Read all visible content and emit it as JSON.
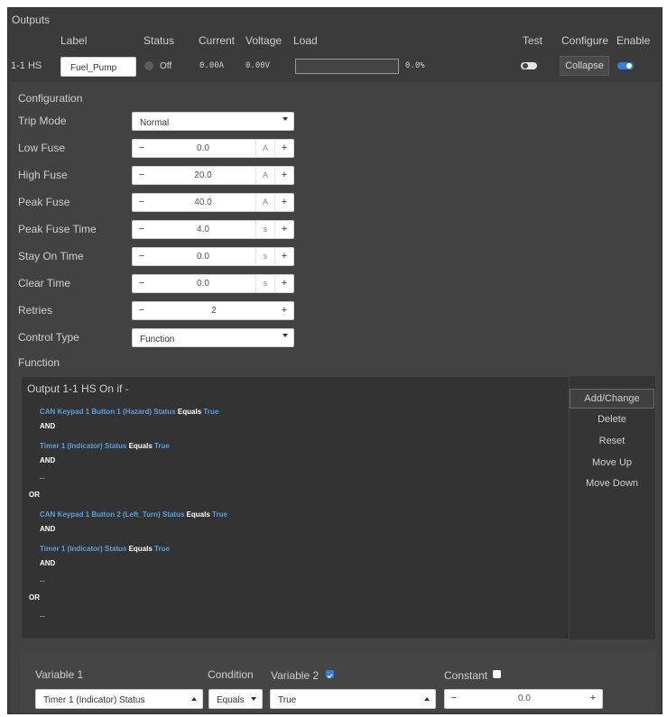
{
  "panel_title": "Outputs",
  "columns": {
    "label": "Label",
    "status": "Status",
    "current": "Current",
    "voltage": "Voltage",
    "load": "Load",
    "test": "Test",
    "configure": "Configure",
    "enable": "Enable"
  },
  "output_row": {
    "id": "1-1 HS",
    "label_value": "Fuel_Pump",
    "status": "Off",
    "current": "0.00A",
    "voltage": "0.00V",
    "load_text": "0.0%",
    "load_fraction": 0.0,
    "test_on": false,
    "configure_label": "Collapse",
    "enable_on": true
  },
  "configuration": {
    "title": "Configuration",
    "trip_mode": {
      "label": "Trip Mode",
      "value": "Normal"
    },
    "low_fuse": {
      "label": "Low Fuse",
      "value": "0.0",
      "unit": "A"
    },
    "high_fuse": {
      "label": "High Fuse",
      "value": "20.0",
      "unit": "A"
    },
    "peak_fuse": {
      "label": "Peak Fuse",
      "value": "40.0",
      "unit": "A"
    },
    "peak_fuse_time": {
      "label": "Peak Fuse Time",
      "value": "4.0",
      "unit": "s"
    },
    "stay_on_time": {
      "label": "Stay On Time",
      "value": "0.0",
      "unit": "s"
    },
    "clear_time": {
      "label": "Clear Time",
      "value": "0.0",
      "unit": "s"
    },
    "retries": {
      "label": "Retries",
      "value": "2"
    },
    "control_type": {
      "label": "Control Type",
      "value": "Function"
    },
    "function_label": "Function"
  },
  "logic": {
    "title": "Output 1-1 HS On if -",
    "cond1": {
      "source": "CAN Keypad 1 Button 1 (Hazard) Status",
      "op": "Equals",
      "value": "True"
    },
    "and1": "AND",
    "cond2": {
      "source": "Timer 1 (Indicator) Status",
      "op": "Equals",
      "value": "True"
    },
    "and2": "AND",
    "dash1": "--",
    "or1": "OR",
    "cond3": {
      "source": "CAN Keypad 1 Button 2 (Left_Turn) Status",
      "op": "Equals",
      "value": "True"
    },
    "and3": "AND",
    "cond4": {
      "source": "Timer 1 (Indicator) Status",
      "op": "Equals",
      "value": "True"
    },
    "and4": "AND",
    "dash2": "--",
    "or2": "OR",
    "dash3": "--"
  },
  "actions": {
    "add_change": "Add/Change",
    "delete": "Delete",
    "reset": "Reset",
    "move_up": "Move Up",
    "move_down": "Move Down"
  },
  "editor": {
    "variable1_label": "Variable 1",
    "condition_label": "Condition",
    "variable2_label": "Variable 2",
    "variable2_checked": true,
    "constant_label": "Constant",
    "constant_checked": false,
    "variable1_value": "Timer 1 (Indicator) Status",
    "condition_value": "Equals",
    "variable2_value": "True",
    "constant_value": "0.0"
  },
  "colors": {
    "accent": "#2f7fe0",
    "condition_text": "#5aa0dc",
    "panel_bg": "#3b3b3b"
  }
}
